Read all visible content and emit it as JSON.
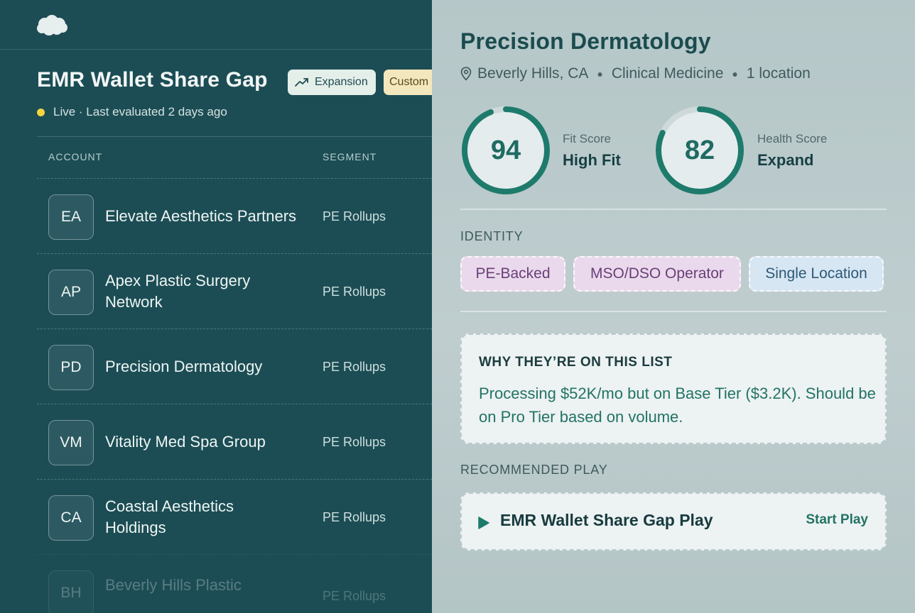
{
  "list": {
    "title": "EMR Wallet Share Gap",
    "chips": {
      "expansion": "Expansion",
      "custom": "Custom"
    },
    "status": "Live · Last evaluated 2 days ago",
    "columns": {
      "account": "ACCOUNT",
      "segment": "SEGMENT"
    },
    "rows": [
      {
        "initials": "EA",
        "name": "Elevate Aesthetics Partners",
        "segment": "PE Rollups"
      },
      {
        "initials": "AP",
        "name": "Apex Plastic Surgery Network",
        "segment": "PE Rollups"
      },
      {
        "initials": "PD",
        "name": "Precision Dermatology",
        "segment": "PE Rollups"
      },
      {
        "initials": "VM",
        "name": "Vitality Med Spa Group",
        "segment": "PE Rollups"
      },
      {
        "initials": "CA",
        "name": "Coastal Aesthetics Holdings",
        "segment": "PE Rollups"
      },
      {
        "initials": "BH",
        "name": "Beverly Hills Plastic",
        "segment": "PE Rollups"
      }
    ]
  },
  "detail": {
    "name": "Precision Dermatology",
    "location": "Beverly Hills, CA",
    "specialty": "Clinical Medicine",
    "locations_count": "1 location",
    "fit": {
      "score": "94",
      "label": "Fit Score",
      "value": "High Fit",
      "fill_fraction": 0.94
    },
    "health": {
      "score": "82",
      "label": "Health Score",
      "value": "Expand",
      "fill_fraction": 0.82
    },
    "identity_label": "IDENTITY",
    "identity_tags": {
      "pe": "PE-Backed",
      "mso": "MSO/DSO Operator",
      "single": "Single Location"
    },
    "why": {
      "title": "WHY THEY’RE ON THIS LIST",
      "body": "Processing $52K/mo but on Base Tier ($3.2K). Should be on Pro Tier based on volume."
    },
    "play_label": "RECOMMENDED PLAY",
    "play": {
      "name": "EMR Wallet Share Gap Play",
      "action": "Start Play"
    }
  },
  "colors": {
    "left_bg": "#1c4d55",
    "accent_teal": "#1e7b6c",
    "live_dot": "#f3d33f"
  }
}
